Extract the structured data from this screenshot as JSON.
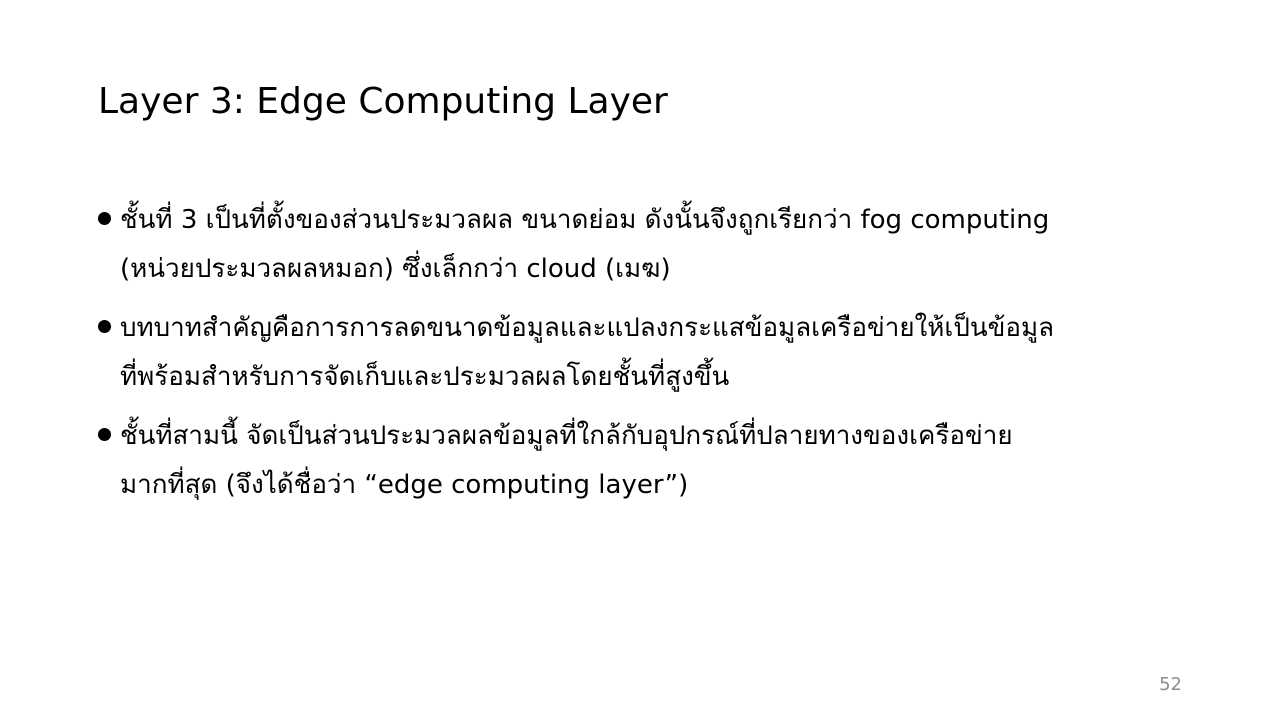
{
  "slide": {
    "title": "Layer 3: Edge Computing Layer",
    "bullets": [
      {
        "lines": [
          "ชั้นที่ 3 เป็นที่ตั้งของส่วนประมวลผล ขนาดย่อม ดังนั้นจึงถูกเรียกว่า fog computing",
          "(หน่วยประมวลผลหมอก) ซึ่งเล็กกว่า cloud (เมฆ)"
        ]
      },
      {
        "lines": [
          "บทบาทสำคัญคือการการลดขนาดข้อมูลและแปลงกระแสข้อมูลเครือข่ายให้เป็นข้อมูล",
          "ที่พร้อมสำหรับการจัดเก็บและประมวลผลโดยชั้นที่สูงขึ้น"
        ]
      },
      {
        "lines": [
          "ชั้นที่สามนี้ จัดเป็นส่วนประมวลผลข้อมูลที่ใกล้กับอุปกรณ์ที่ปลายทางของเครือข่าย",
          "มากที่สุด (จึงได้ชื่อว่า “edge computing layer”)"
        ]
      }
    ],
    "page_number": "52"
  },
  "colors": {
    "background": "#ffffff",
    "text": "#000000",
    "page_number": "#8c8c8c"
  }
}
